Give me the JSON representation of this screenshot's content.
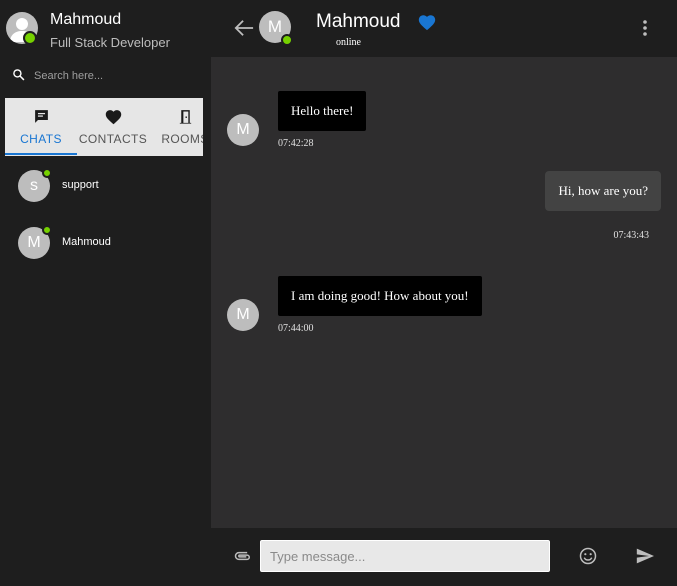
{
  "profile": {
    "name": "Mahmoud",
    "role": "Full Stack Developer",
    "avatar_icon": "person-icon",
    "status_color": "#76d100"
  },
  "search": {
    "placeholder": "Search here..."
  },
  "tabs": [
    {
      "label": "CHATS",
      "icon": "chat-icon",
      "active": true
    },
    {
      "label": "CONTACTS",
      "icon": "heart-icon",
      "active": false
    },
    {
      "label": "ROOMS",
      "icon": "door-icon",
      "active": false
    }
  ],
  "contacts": [
    {
      "initial": "s",
      "name": "support",
      "online": true
    },
    {
      "initial": "M",
      "name": "Mahmoud",
      "online": true
    }
  ],
  "header": {
    "initial": "M",
    "name": "Mahmoud",
    "status": "online",
    "favorite_color": "#1976d2"
  },
  "messages": [
    {
      "from": "them",
      "initial": "M",
      "text": "Hello there!",
      "time": "07:42:28"
    },
    {
      "from": "me",
      "text": "Hi, how are you?",
      "time": "07:43:43"
    },
    {
      "from": "them",
      "initial": "M",
      "text": "I am doing good! How about you!",
      "time": "07:44:00"
    }
  ],
  "composer": {
    "placeholder": "Type message..."
  },
  "colors": {
    "accent": "#1976d2",
    "online": "#76d100",
    "chat_bg": "#2e2d2e",
    "incoming_bubble": "#000000",
    "outgoing_bubble": "#434343"
  }
}
